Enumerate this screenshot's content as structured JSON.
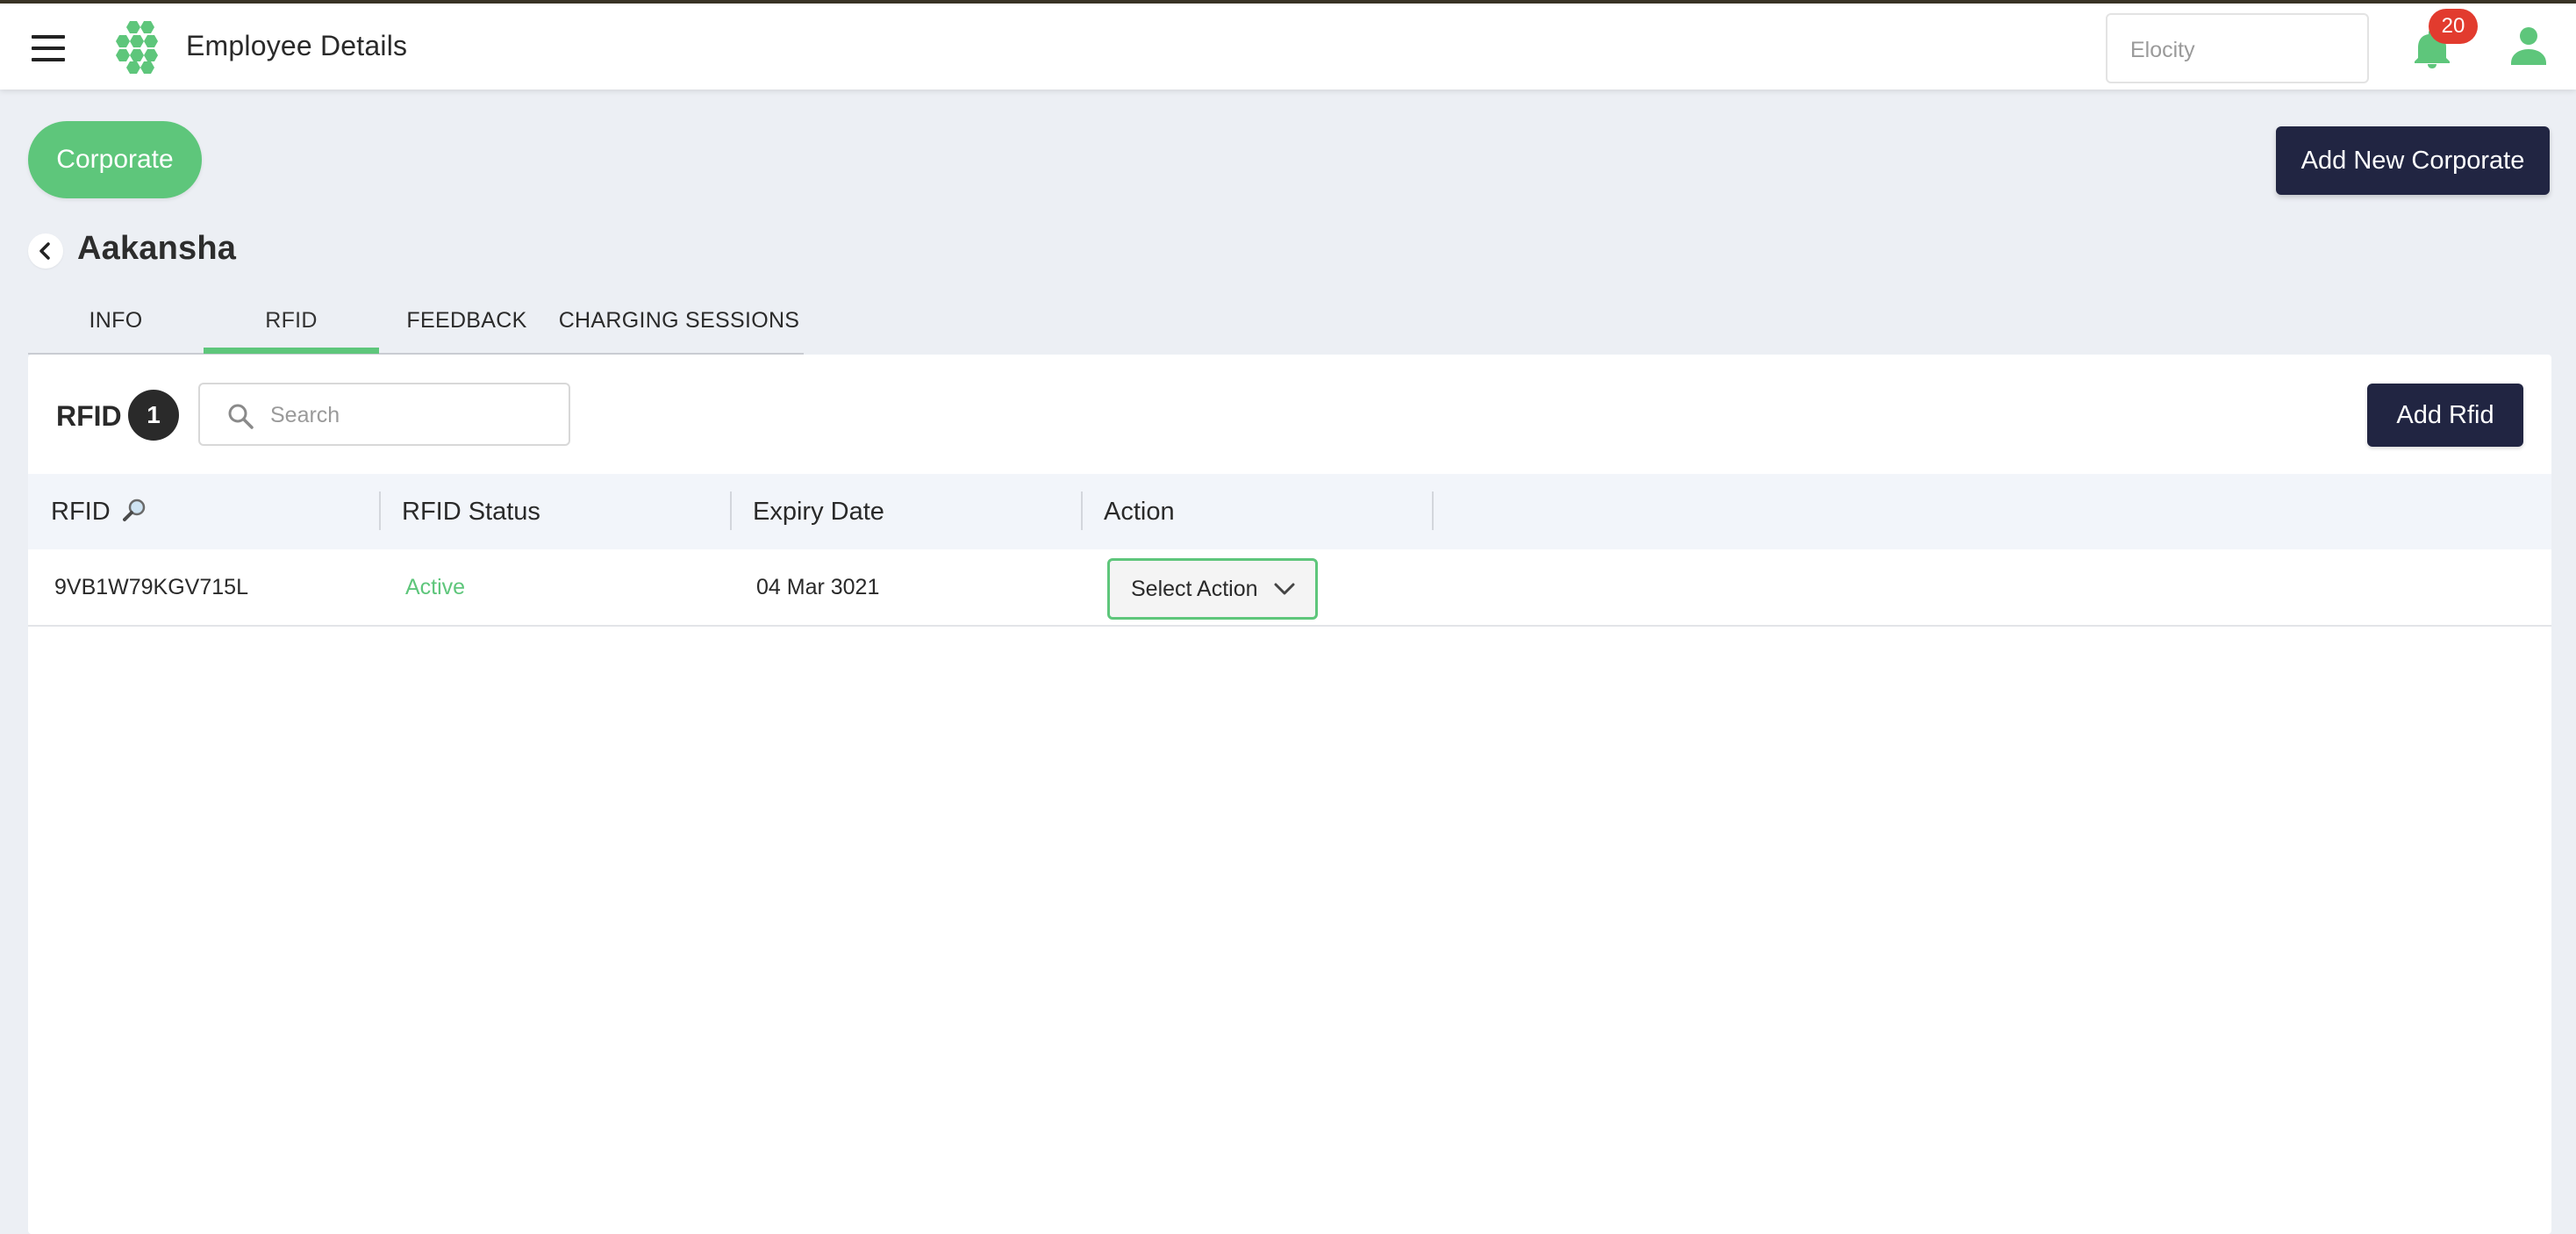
{
  "header": {
    "title": "Employee Details",
    "org_select_value": "Elocity",
    "notification_count": "20",
    "menu_icon": "hamburger-menu-icon",
    "logo_icon": "hexagon-cluster-logo",
    "bell_icon": "bell-icon",
    "user_icon": "person-icon"
  },
  "actions": {
    "corporate_label": "Corporate",
    "add_corporate_label": "Add New Corporate"
  },
  "employee": {
    "name": "Aakansha",
    "back_icon": "chevron-left-icon"
  },
  "tabs": [
    {
      "label": "INFO",
      "active": false
    },
    {
      "label": "RFID",
      "active": true
    },
    {
      "label": "FEEDBACK",
      "active": false
    },
    {
      "label": "CHARGING SESSIONS",
      "active": false
    }
  ],
  "rfid_panel": {
    "title": "RFID",
    "count": "1",
    "search_placeholder": "Search",
    "add_label": "Add Rfid",
    "columns": [
      "RFID",
      "RFID Status",
      "Expiry Date",
      "Action"
    ],
    "rows": [
      {
        "rfid": "9VB1W79KGV715L",
        "status": "Active",
        "expiry": "04 Mar 3021",
        "action_label": "Select Action"
      }
    ]
  },
  "colors": {
    "accent_green": "#5ec67b",
    "dark_navy": "#212542",
    "badge_red": "#e23b2e",
    "page_bg": "#eceff4"
  }
}
